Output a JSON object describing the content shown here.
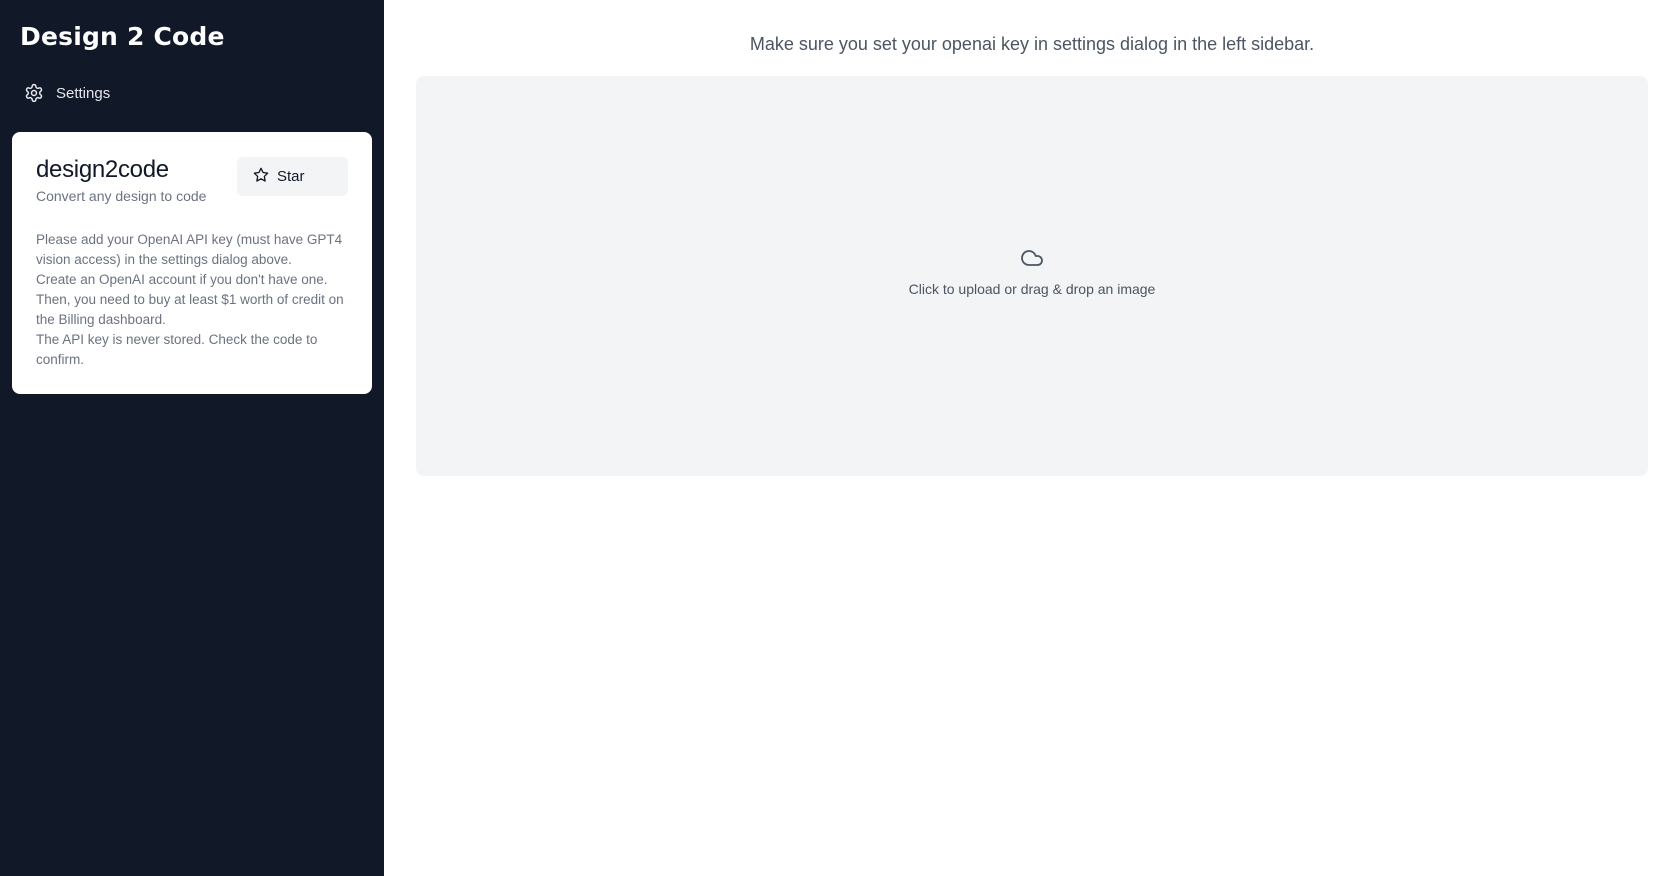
{
  "sidebar": {
    "app_title": "Design 2 Code",
    "settings_label": "Settings",
    "settings_icon": "gear-icon",
    "repo_card": {
      "name": "design2code",
      "subtitle": "Convert any design to code",
      "star_label": "Star",
      "star_icon": "star-icon",
      "description": [
        "Please add your OpenAI API key (must have GPT4 vision access) in the settings dialog above.",
        "Create an OpenAI account if you don't have one.",
        "Then, you need to buy at least $1 worth of credit on the Billing dashboard.",
        "The API key is never stored. Check the code to confirm."
      ]
    }
  },
  "main": {
    "notice": "Make sure you set your openai key in settings dialog in the left sidebar.",
    "dropzone": {
      "icon": "cloud-icon",
      "text": "Click to upload or drag & drop an image"
    }
  },
  "colors": {
    "sidebar_bg": "#111827",
    "dropzone_bg": "#f3f4f6",
    "card_bg": "#ffffff"
  }
}
